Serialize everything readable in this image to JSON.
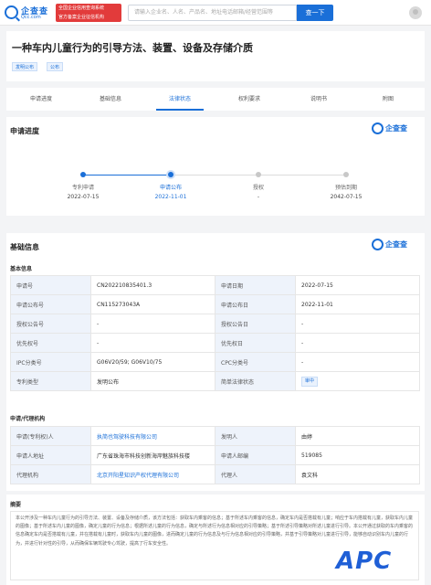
{
  "header": {
    "logo_name": "企查查",
    "logo_domain": "Qcc.com",
    "promo_line1": "全国企业信用查询系统",
    "promo_line2": "官方备案企业征信机构",
    "search_placeholder": "请输入企业名、人名、产品名、地址电话邮箱/经营范围等",
    "search_button": "查一下"
  },
  "title": {
    "text": "一种车内儿童行为的引导方法、装置、设备及存储介质",
    "tags": [
      "发明公布",
      "公布"
    ]
  },
  "tabs": [
    {
      "label": "申请进度",
      "active": false
    },
    {
      "label": "基础信息",
      "active": false
    },
    {
      "label": "法律状态",
      "active": true
    },
    {
      "label": "权利要求",
      "active": false
    },
    {
      "label": "说明书",
      "active": false
    },
    {
      "label": "附图",
      "active": false
    }
  ],
  "progress": {
    "title": "申请进度",
    "brand": "企查查",
    "steps": [
      {
        "label": "专利申请",
        "date": "2022-07-15",
        "state": "done"
      },
      {
        "label": "申请公布",
        "date": "2022-11-01",
        "state": "current"
      },
      {
        "label": "授权",
        "date": "-",
        "state": "pending"
      },
      {
        "label": "预估到期",
        "date": "2042-07-15",
        "state": "pending"
      }
    ]
  },
  "basic": {
    "title": "基础信息",
    "brand": "企查查",
    "sub1": "基本信息",
    "rows": [
      {
        "k1": "申请号",
        "v1": "CN202210835401.3",
        "k2": "申请日期",
        "v2": "2022-07-15"
      },
      {
        "k1": "申请公布号",
        "v1": "CN115273043A",
        "k2": "申请公布日",
        "v2": "2022-11-01"
      },
      {
        "k1": "授权公告号",
        "v1": "-",
        "k2": "授权公告日",
        "v2": "-"
      },
      {
        "k1": "优先权号",
        "v1": "-",
        "k2": "优先权日",
        "v2": "-"
      },
      {
        "k1": "IPC分类号",
        "v1": "G06V20/59; G06V10/75",
        "k2": "CPC分类号",
        "v2": "-"
      },
      {
        "k1": "专利类型",
        "v1": "发明公布",
        "k2": "简单法律状态",
        "v2": "审中"
      }
    ],
    "sub2": "申请/代理机构",
    "rows2": [
      {
        "k1": "申请(专利权)人",
        "v1": "执简也驾驶科技有限公司",
        "k2": "发明人",
        "v2": "由婷"
      },
      {
        "k1": "申请人地址",
        "v1": "广东省珠海市科技创新海岸魅族科技楼",
        "k2": "申请人邮编",
        "v2": "519085"
      },
      {
        "k1": "代理机构",
        "v1": "北京开阳星知识产权代理有限公司",
        "k2": "代理人",
        "v2": "袁文科"
      }
    ]
  },
  "abstract": {
    "title": "摘要",
    "text": "本公开涉及一种车内儿童行为的引导方法、装置、设备及存储介质，该方法包括：获取车内乘客的信息；基于所述车内乘客的信息，确定车内是否搭载有儿童；响应于车内搭载有儿童，获取车内儿童的图像；基于所述车内儿童的图像，确定儿童的行为信息；根据所述儿童的行为信息，确定与所述行为信息相对应的引导策略；基于所述引导策略对所述儿童进行引导。本公开通过获取的车内乘客的信息确定车内是否搭载有儿童，并在搭载有儿童时，获取车内儿童的图像，进而确定儿童的行为信息及与行为信息相对应的引导策略，并基于引导策略对儿童进行引导，能够自动识别车内儿童的行为，并进行针对性的引导，从而确保车辆驾驶专心驾驶，提高了行车安全性。",
    "watermark": "APC"
  }
}
